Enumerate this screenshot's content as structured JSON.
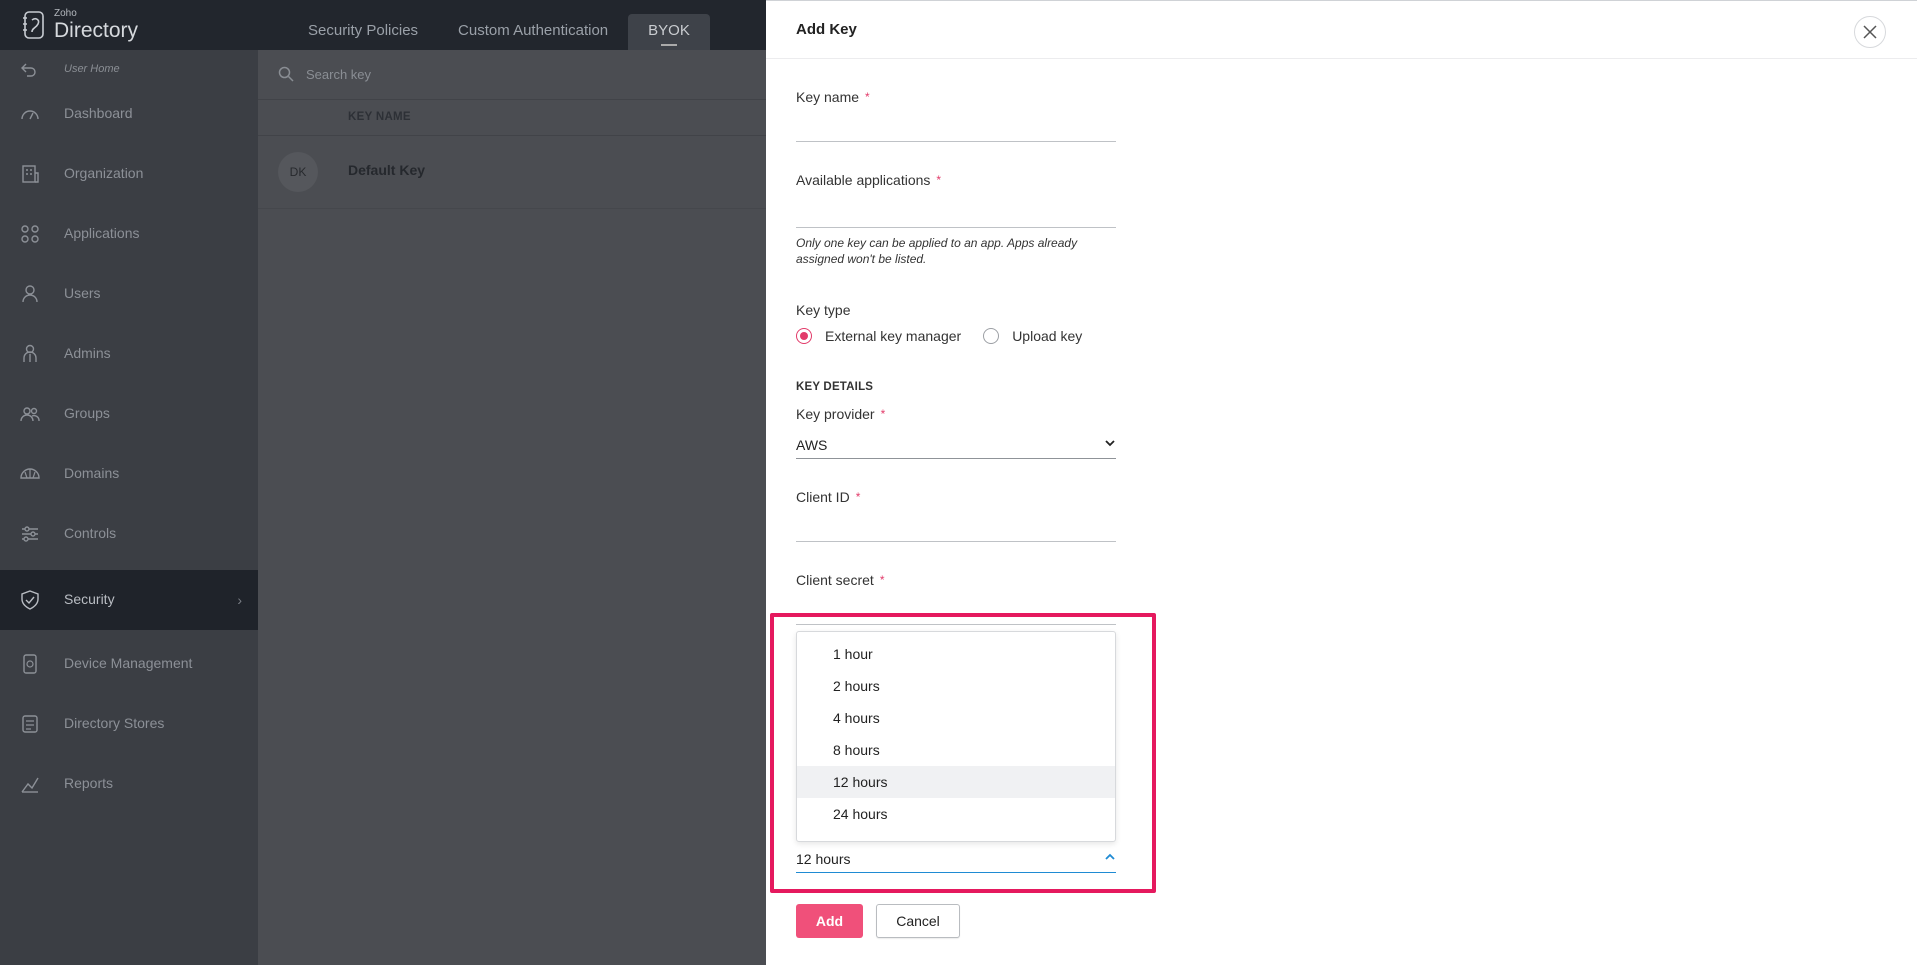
{
  "app": {
    "logo_small": "Zoho",
    "logo_big": "Directory"
  },
  "tabs": [
    {
      "label": "Security Policies"
    },
    {
      "label": "Custom Authentication"
    },
    {
      "label": "BYOK"
    }
  ],
  "sidebar": {
    "user_home": "User Home",
    "items": [
      {
        "label": "Dashboard",
        "icon": "dashboard-icon"
      },
      {
        "label": "Organization",
        "icon": "organization-icon"
      },
      {
        "label": "Applications",
        "icon": "applications-icon"
      },
      {
        "label": "Users",
        "icon": "user-icon"
      },
      {
        "label": "Admins",
        "icon": "admin-icon"
      },
      {
        "label": "Groups",
        "icon": "groups-icon"
      },
      {
        "label": "Domains",
        "icon": "domains-icon"
      },
      {
        "label": "Controls",
        "icon": "controls-icon"
      },
      {
        "label": "Security",
        "icon": "shield-icon",
        "active": true
      },
      {
        "label": "Device Management",
        "icon": "device-icon"
      },
      {
        "label": "Directory Stores",
        "icon": "stores-icon"
      },
      {
        "label": "Reports",
        "icon": "reports-icon"
      }
    ]
  },
  "main": {
    "search_placeholder": "Search key",
    "column_header": "KEY NAME",
    "rows": [
      {
        "avatar": "DK",
        "name": "Default Key"
      }
    ]
  },
  "drawer": {
    "title": "Add Key",
    "key_name_label": "Key name",
    "available_apps_label": "Available applications",
    "helper_text": "Only one key can be applied to an app. Apps already assigned won't be listed.",
    "key_type_label": "Key type",
    "key_type_options": [
      "External key manager",
      "Upload key"
    ],
    "key_type_selected": "External key manager",
    "key_details_heading": "KEY DETAILS",
    "key_provider_label": "Key provider",
    "key_provider_value": "AWS",
    "client_id_label": "Client ID",
    "client_secret_label": "Client secret",
    "required_mark": "*",
    "duration_options": [
      "1 hour",
      "2 hours",
      "4 hours",
      "8 hours",
      "12 hours",
      "24 hours"
    ],
    "duration_value": "12 hours",
    "add_button": "Add",
    "cancel_button": "Cancel"
  },
  "colors": {
    "accent": "#e23b6a",
    "highlight": "#e5195e",
    "focus": "#1f8bd3",
    "primary_button": "#f0507a"
  }
}
